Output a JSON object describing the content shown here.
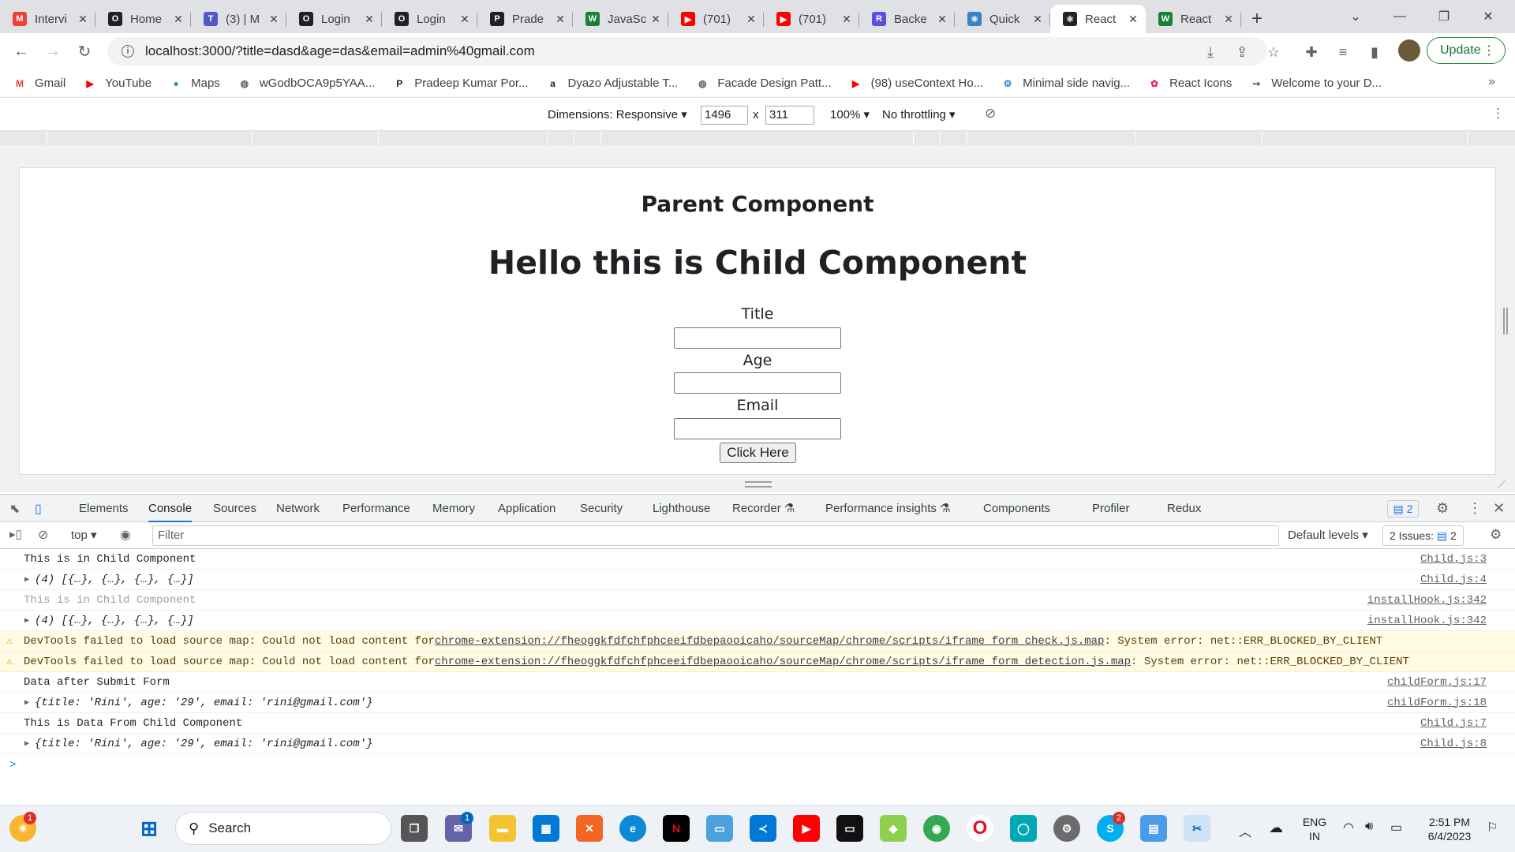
{
  "browser": {
    "tabs": [
      {
        "label": "Intervi",
        "color": "#ea4335",
        "glyph": "M"
      },
      {
        "label": "Home",
        "color": "#202124",
        "glyph": "O"
      },
      {
        "label": "(3) | M",
        "color": "#5059c9",
        "glyph": "T"
      },
      {
        "label": "Login",
        "color": "#202124",
        "glyph": "O"
      },
      {
        "label": "Login",
        "color": "#202124",
        "glyph": "O"
      },
      {
        "label": "Prade",
        "color": "#202124",
        "glyph": "P"
      },
      {
        "label": "JavaSc",
        "color": "#1a7f37",
        "glyph": "W"
      },
      {
        "label": "(701)",
        "color": "#ff0000",
        "glyph": "▶"
      },
      {
        "label": "(701)",
        "color": "#ff0000",
        "glyph": "▶"
      },
      {
        "label": "Backe",
        "color": "#5b4ee0",
        "glyph": "R"
      },
      {
        "label": "Quick",
        "color": "#3b82c4",
        "glyph": "⚛"
      },
      {
        "label": "React",
        "color": "#20232a",
        "glyph": "⚛"
      },
      {
        "label": "React",
        "color": "#1a7f37",
        "glyph": "W"
      }
    ],
    "url": "localhost:3000/?title=dasd&age=das&email=admin%40gmail.com",
    "update_label": "Update",
    "bookmarks": [
      {
        "label": "Gmail",
        "color": "#ea4335",
        "glyph": "M"
      },
      {
        "label": "YouTube",
        "color": "#ff0000",
        "glyph": "▶"
      },
      {
        "label": "Maps",
        "color": "#34a853",
        "glyph": "●"
      },
      {
        "label": "wGodbOCA9p5YAA...",
        "color": "#5f6368",
        "glyph": "◍"
      },
      {
        "label": "Pradeep Kumar Por...",
        "color": "#202124",
        "glyph": "P"
      },
      {
        "label": "Dyazo Adjustable T...",
        "color": "#202124",
        "glyph": "a"
      },
      {
        "label": "Facade Design Patt...",
        "color": "#5f6368",
        "glyph": "◍"
      },
      {
        "label": "(98) useContext Ho...",
        "color": "#ff0000",
        "glyph": "▶"
      },
      {
        "label": "Minimal side navig...",
        "color": "#3b82c4",
        "glyph": "⚙"
      },
      {
        "label": "React Icons",
        "color": "#e91e63",
        "glyph": "✿"
      },
      {
        "label": "Welcome to your D...",
        "color": "#5f6368",
        "glyph": "⇝"
      }
    ]
  },
  "device_toolbar": {
    "dimensions_label": "Dimensions: Responsive",
    "width": "1496",
    "height": "311",
    "times": "x",
    "zoom": "100%",
    "throttling": "No throttling"
  },
  "page": {
    "parent_title": "Parent Component",
    "child_title": "Hello this is Child Component",
    "title_label": "Title",
    "age_label": "Age",
    "email_label": "Email",
    "button_label": "Click Here"
  },
  "devtools": {
    "tabs": [
      "Elements",
      "Console",
      "Sources",
      "Network",
      "Performance",
      "Memory",
      "Application",
      "Security",
      "Lighthouse",
      "Recorder ⚗",
      "Performance insights ⚗",
      "Components",
      "Profiler",
      "Redux"
    ],
    "active_tab": "Console",
    "issues_badge": "2",
    "context": "top",
    "filter_placeholder": "Filter",
    "levels": "Default levels",
    "issues_label": "2 Issues:",
    "issues_count": "2",
    "console_lines": [
      {
        "text": "This is in Child Component",
        "source": "Child.js:3",
        "kind": "log"
      },
      {
        "text": "(4) [{…}, {…}, {…}, {…}]",
        "source": "Child.js:4",
        "kind": "array"
      },
      {
        "text": "This is in Child Component",
        "source": "installHook.js:342",
        "kind": "dim"
      },
      {
        "text": "(4) [{…}, {…}, {…}, {…}]",
        "source": "installHook.js:342",
        "kind": "array"
      },
      {
        "text_prefix": "DevTools failed to load source map: Could not load content for ",
        "link": "chrome-extension://fheoggkfdfchfphceeifdbepaooicaho/sourceMap/chrome/scripts/iframe_form_check.js.map",
        "text_suffix": ": System error: net::ERR_BLOCKED_BY_CLIENT",
        "kind": "warn"
      },
      {
        "text_prefix": "DevTools failed to load source map: Could not load content for ",
        "link": "chrome-extension://fheoggkfdfchfphceeifdbepaooicaho/sourceMap/chrome/scripts/iframe_form_detection.js.map",
        "text_suffix": ": System error: net::ERR_BLOCKED_BY_CLIENT",
        "kind": "warn"
      },
      {
        "text": "Data after Submit Form",
        "source": "childForm.js:17",
        "kind": "log"
      },
      {
        "text": "{title: 'Rini', age: '29', email: 'rini@gmail.com'}",
        "source": "childForm.js:18",
        "kind": "object"
      },
      {
        "text": "This is Data From Child Component",
        "source": "Child.js:7",
        "kind": "log"
      },
      {
        "text": "{title: 'Rini', age: '29', email: 'rini@gmail.com'}",
        "source": "Child.js:8",
        "kind": "object"
      }
    ],
    "prompt": ">"
  },
  "taskbar": {
    "search_label": "Search",
    "lang_top": "ENG",
    "lang_bottom": "IN",
    "time": "2:51 PM",
    "date": "6/4/2023",
    "weather_badge": "1",
    "chat_badge": "1",
    "skype_badge": "2"
  }
}
